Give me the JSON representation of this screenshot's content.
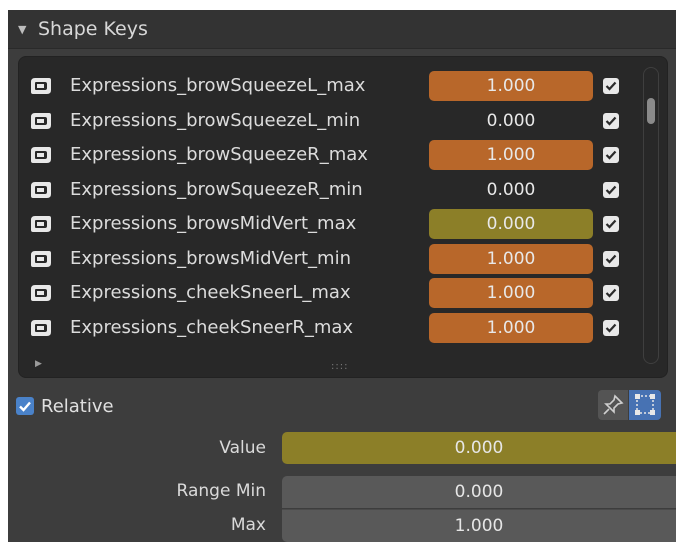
{
  "header": {
    "title": "Shape Keys"
  },
  "colors": {
    "orange": "#b8672a",
    "olive": "#8c7f28",
    "dark_field": "#595959",
    "accent_blue": "#4a82c9"
  },
  "shape_keys": [
    {
      "name": "Expressions_browSqueezeL_max",
      "value": "1.000",
      "color": "orange"
    },
    {
      "name": "Expressions_browSqueezeL_min",
      "value": "0.000",
      "color": "none"
    },
    {
      "name": "Expressions_browSqueezeR_max",
      "value": "1.000",
      "color": "orange"
    },
    {
      "name": "Expressions_browSqueezeR_min",
      "value": "0.000",
      "color": "none"
    },
    {
      "name": "Expressions_browsMidVert_max",
      "value": "0.000",
      "color": "olive"
    },
    {
      "name": "Expressions_browsMidVert_min",
      "value": "1.000",
      "color": "orange"
    },
    {
      "name": "Expressions_cheekSneerL_max",
      "value": "1.000",
      "color": "orange"
    },
    {
      "name": "Expressions_cheekSneerR_max",
      "value": "1.000",
      "color": "orange"
    }
  ],
  "relative": {
    "label": "Relative",
    "checked": true
  },
  "properties": {
    "value_label": "Value",
    "value": "0.000",
    "range_min_label": "Range Min",
    "range_min": "0.000",
    "max_label": "Max",
    "max": "1.000"
  },
  "icons": [
    "shape-key-icon",
    "checkbox-icon",
    "pin-icon",
    "edit-mode-icon",
    "disclosure-triangle-icon"
  ]
}
